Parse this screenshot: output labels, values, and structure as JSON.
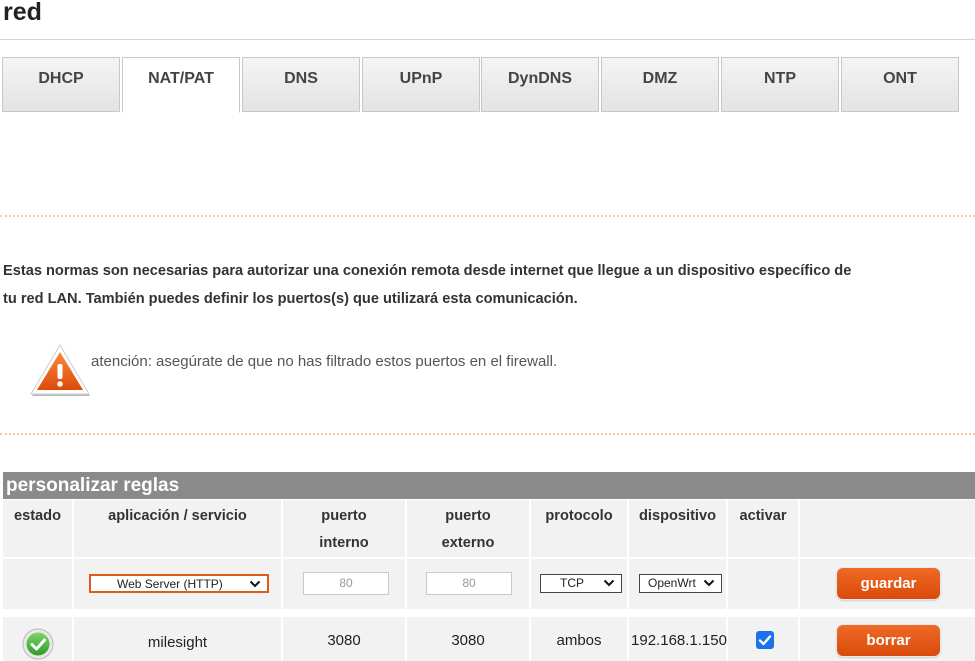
{
  "page": {
    "title": "red"
  },
  "tabs": [
    {
      "label": "DHCP",
      "active": false
    },
    {
      "label": "NAT/PAT",
      "active": true
    },
    {
      "label": "DNS",
      "active": false
    },
    {
      "label": "UPnP",
      "active": false
    },
    {
      "label": "DynDNS",
      "active": false
    },
    {
      "label": "DMZ",
      "active": false
    },
    {
      "label": "NTP",
      "active": false
    },
    {
      "label": "ONT",
      "active": false
    }
  ],
  "intro": {
    "line1": "Estas normas son necesarias para autorizar una conexión remota desde internet que llegue a un dispositivo específico de",
    "line2": "tu red LAN. También puedes definir los puertos(s) que utilizará esta comunicación."
  },
  "warning": {
    "text": "atención: asegúrate de que no has filtrado estos puertos en el firewall."
  },
  "rules": {
    "title": "personalizar reglas",
    "headers": {
      "estado": "estado",
      "aplicacion": "aplicación / servicio",
      "puerto_interno_1": "puerto",
      "puerto_interno_2": "interno",
      "puerto_externo_1": "puerto",
      "puerto_externo_2": "externo",
      "protocolo": "protocolo",
      "dispositivo": "dispositivo",
      "activar": "activar"
    },
    "new_rule": {
      "service": "Web Server (HTTP)",
      "internal_port_placeholder": "80",
      "external_port_placeholder": "80",
      "protocol": "TCP",
      "device": "OpenWrt",
      "save_label": "guardar"
    },
    "existing": [
      {
        "status_icon": "check-circle-icon",
        "service": "milesight",
        "internal_port": "3080",
        "external_port": "3080",
        "protocol": "ambos",
        "device": "192.168.1.150",
        "active": true,
        "delete_label": "borrar"
      }
    ]
  },
  "colors": {
    "accent": "#e25412",
    "header_bar": "#8a8a8a",
    "row_bg": "#f2f2f2",
    "checkbox": "#1a73e8"
  }
}
